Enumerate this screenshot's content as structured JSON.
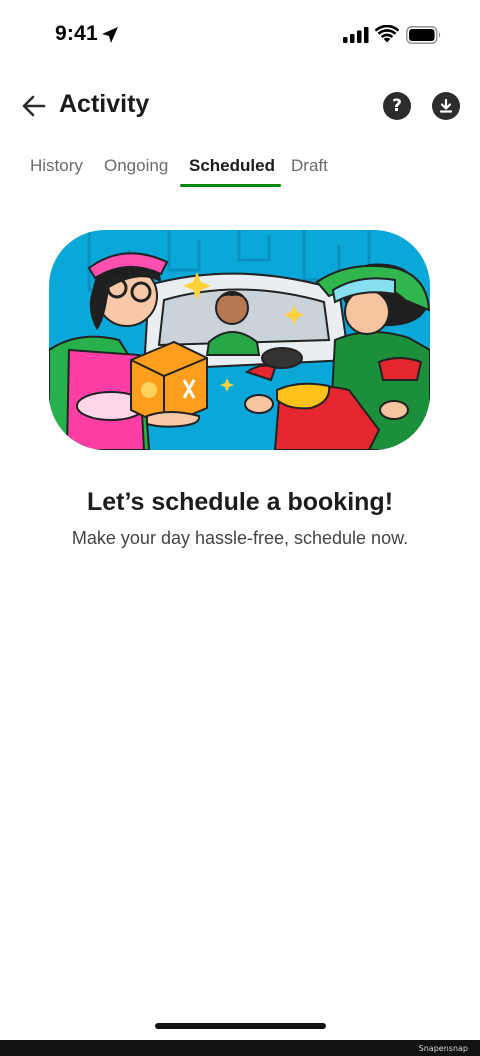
{
  "status_bar": {
    "time": "9:41"
  },
  "header": {
    "title": "Activity",
    "back_icon": "arrow-left-icon",
    "help_icon": "question-circle-icon",
    "help_glyph": "?",
    "download_icon": "download-icon"
  },
  "tabs": [
    {
      "label": "History",
      "active": false
    },
    {
      "label": "Ongoing",
      "active": false
    },
    {
      "label": "Scheduled",
      "active": true
    },
    {
      "label": "Draft",
      "active": false
    }
  ],
  "empty_state": {
    "title": "Let’s schedule a booking!",
    "subtitle": "Make your day hassle-free, schedule now."
  },
  "watermark": "Snapensnap",
  "colors": {
    "accent": "#00880a",
    "illustration_bg": "#0aa7d9",
    "icon_bg": "#2d2d2d"
  }
}
